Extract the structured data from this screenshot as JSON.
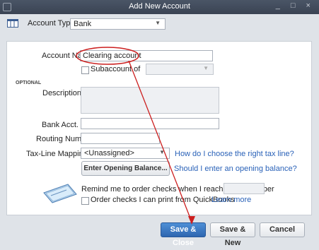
{
  "window": {
    "title": "Add New Account",
    "controls": "_ □ ×"
  },
  "account_type": {
    "label": "Account Type",
    "value": "Bank"
  },
  "account_name": {
    "label": "Account Name",
    "value": "Clearing account"
  },
  "subaccount": {
    "label": "Subaccount of"
  },
  "optional_header": "OPTIONAL",
  "description": {
    "label": "Description"
  },
  "bank_acct_no": {
    "label": "Bank Acct. No."
  },
  "routing_number": {
    "label": "Routing Number"
  },
  "tax_line": {
    "label": "Tax-Line Mapping",
    "value": "<Unassigned>",
    "help_link": "How do I choose the right tax line?"
  },
  "opening_balance": {
    "button_label": "Enter Opening Balance...",
    "help_link": "Should I enter an opening balance?"
  },
  "checks": {
    "remind_text": "Remind me to order checks when I reach check number",
    "order_label": "Order checks I can print from QuickBooks",
    "learn_more": "Learn more"
  },
  "buttons": {
    "save_close": "Save & Close",
    "save_new": "Save & New",
    "cancel": "Cancel"
  },
  "colors": {
    "accent": "#2e66b0",
    "annotation": "#cc1f1f",
    "link": "#2a62b8"
  }
}
